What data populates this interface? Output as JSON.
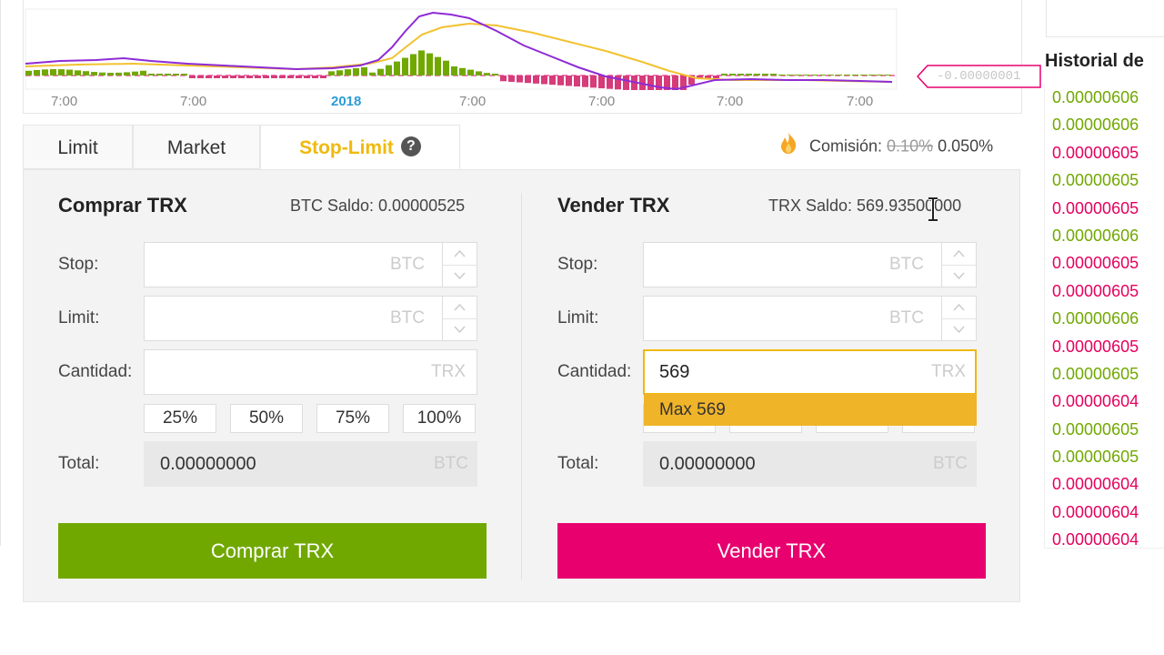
{
  "chart": {
    "x_ticks": [
      "7:00",
      "7:00",
      "2018",
      "7:00",
      "7:00",
      "7:00",
      "7:00"
    ],
    "macd_value": "-0.00000001"
  },
  "tabs": [
    {
      "label": "Limit"
    },
    {
      "label": "Market"
    },
    {
      "label": "Stop-Limit"
    }
  ],
  "fee": {
    "label": "Comisión:",
    "old": "0.10%",
    "new": "0.050%"
  },
  "buy": {
    "title": "Comprar TRX",
    "balance": "BTC Saldo: 0.00000525",
    "stop_label": "Stop:",
    "limit_label": "Limit:",
    "amount_label": "Cantidad:",
    "total_label": "Total:",
    "stop_unit": "BTC",
    "limit_unit": "BTC",
    "amount_unit": "TRX",
    "total_value": "0.00000000",
    "total_unit": "BTC",
    "percents": [
      "25%",
      "50%",
      "75%",
      "100%"
    ],
    "button": "Comprar TRX"
  },
  "sell": {
    "title": "Vender TRX",
    "balance": "TRX Saldo: 569.93500000",
    "stop_label": "Stop:",
    "limit_label": "Limit:",
    "amount_label": "Cantidad:",
    "total_label": "Total:",
    "stop_unit": "BTC",
    "limit_unit": "BTC",
    "amount_value": "569",
    "amount_unit": "TRX",
    "max_suggestion": "Max 569",
    "total_value": "0.00000000",
    "total_unit": "BTC",
    "button": "Vender TRX"
  },
  "history": {
    "title": "Historial de",
    "rows": [
      {
        "price": "0.00000606",
        "side": "buy"
      },
      {
        "price": "0.00000606",
        "side": "buy"
      },
      {
        "price": "0.00000605",
        "side": "sell"
      },
      {
        "price": "0.00000605",
        "side": "buy"
      },
      {
        "price": "0.00000605",
        "side": "sell"
      },
      {
        "price": "0.00000606",
        "side": "buy"
      },
      {
        "price": "0.00000605",
        "side": "sell"
      },
      {
        "price": "0.00000605",
        "side": "sell"
      },
      {
        "price": "0.00000606",
        "side": "buy"
      },
      {
        "price": "0.00000605",
        "side": "sell"
      },
      {
        "price": "0.00000605",
        "side": "buy"
      },
      {
        "price": "0.00000604",
        "side": "sell"
      },
      {
        "price": "0.00000605",
        "side": "buy"
      },
      {
        "price": "0.00000605",
        "side": "buy"
      },
      {
        "price": "0.00000604",
        "side": "sell"
      },
      {
        "price": "0.00000604",
        "side": "sell"
      },
      {
        "price": "0.00000604",
        "side": "sell"
      }
    ]
  },
  "colors": {
    "accent": "#f0b90b",
    "buy": "#70a800",
    "sell": "#e8006e",
    "macd_line": "#8e2bd6",
    "signal_line": "#f2c230"
  }
}
